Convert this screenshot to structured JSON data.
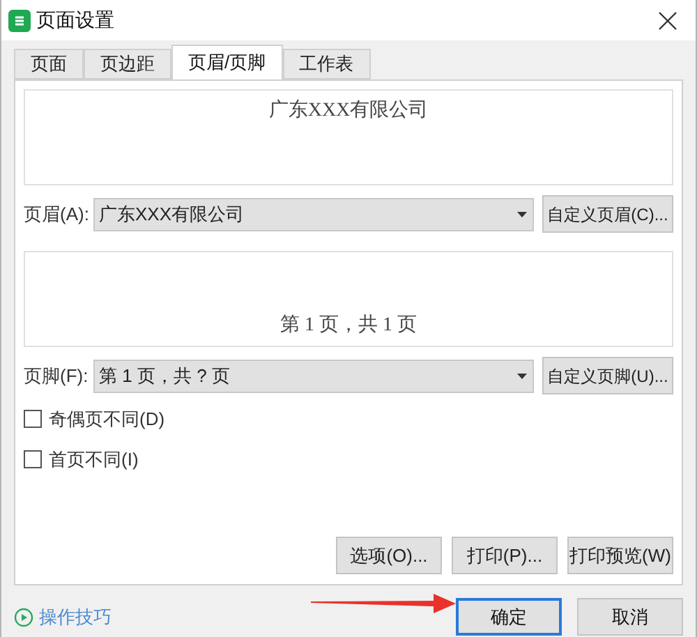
{
  "window": {
    "title": "页面设置"
  },
  "tabs": [
    {
      "label": "页面",
      "selected": false
    },
    {
      "label": "页边距",
      "selected": false
    },
    {
      "label": "页眉/页脚",
      "selected": true
    },
    {
      "label": "工作表",
      "selected": false
    }
  ],
  "header": {
    "preview": "广东XXX有限公司",
    "label": "页眉(A):",
    "value": "广东XXX有限公司",
    "custom_button": "自定义页眉(C)..."
  },
  "footer": {
    "preview": "第 1 页，共 1 页",
    "label": "页脚(F):",
    "value": "第 1 页，共 ? 页",
    "custom_button": "自定义页脚(U)..."
  },
  "options": [
    {
      "label": "奇偶页不同(D)",
      "checked": false
    },
    {
      "label": "首页不同(I)",
      "checked": false
    }
  ],
  "panel_buttons": [
    "选项(O)...",
    "打印(P)...",
    "打印预览(W)"
  ],
  "tips_link": "操作技巧",
  "dialog_buttons": [
    {
      "label": "确定",
      "selected": true
    },
    {
      "label": "取消",
      "selected": false
    }
  ]
}
